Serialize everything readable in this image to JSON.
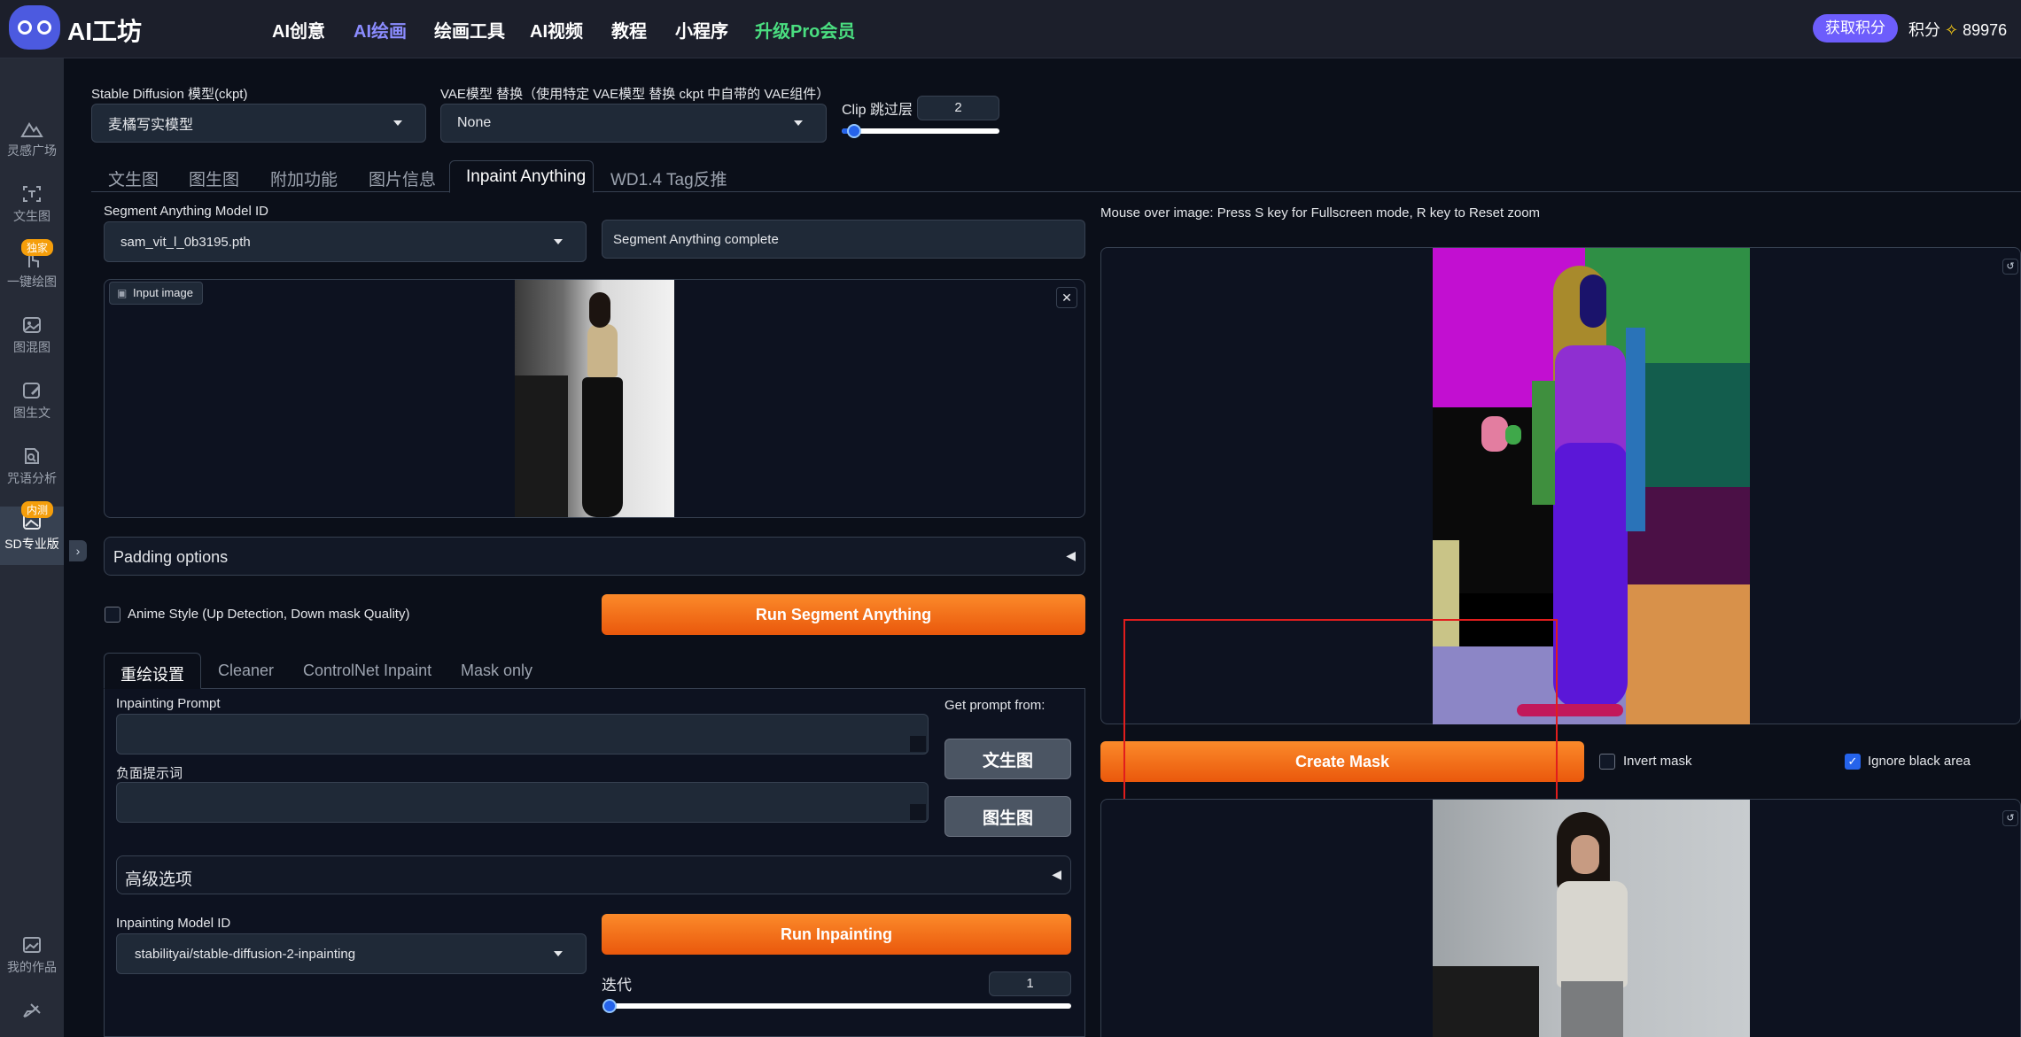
{
  "header": {
    "logo_text": "AI工坊",
    "nav": [
      "AI创意",
      "AI绘画",
      "绘画工具",
      "AI视频",
      "教程",
      "小程序",
      "升级Pro会员"
    ],
    "active_nav": "AI绘画",
    "get_points_label": "获取积分",
    "points_label": "积分",
    "points_value": "89976"
  },
  "sidebar": {
    "items": [
      {
        "label": "灵感广场",
        "icon": "mountain-icon"
      },
      {
        "label": "文生图",
        "icon": "text-frame-icon"
      },
      {
        "label": "一键绘图",
        "icon": "hand-pointer-icon",
        "badge": "独家"
      },
      {
        "label": "图混图",
        "icon": "image-mix-icon"
      },
      {
        "label": "图生文",
        "icon": "image-edit-icon"
      },
      {
        "label": "咒语分析",
        "icon": "analysis-icon"
      },
      {
        "label": "SD专业版",
        "icon": "image-pro-icon",
        "badge": "内测"
      }
    ],
    "bottom_items": [
      {
        "label": "我的作品",
        "icon": "gallery-icon"
      },
      {
        "label": "",
        "icon": "brush-icon"
      }
    ]
  },
  "model_bar": {
    "ckpt_label": "Stable Diffusion 模型(ckpt)",
    "ckpt_value": "麦橘写实模型",
    "vae_label": "VAE模型 替换（使用特定 VAE模型 替换 ckpt 中自带的 VAE组件）",
    "vae_value": "None",
    "clip_label": "Clip 跳过层",
    "clip_value": "2",
    "clip_slider_fraction": 0.08
  },
  "main_tabs": [
    "文生图",
    "图生图",
    "附加功能",
    "图片信息",
    "Inpaint Anything",
    "WD1.4 Tag反推"
  ],
  "active_main_tab": "Inpaint Anything",
  "left": {
    "sam_label": "Segment Anything Model ID",
    "sam_value": "sam_vit_l_0b3195.pth",
    "sam_status": "Segment Anything complete",
    "input_image_label": "Input image",
    "padding_options": "Padding options",
    "anime_style_label": "Anime Style (Up Detection, Down mask Quality)",
    "run_sam_label": "Run Segment Anything",
    "sub_tabs": [
      "重绘设置",
      "Cleaner",
      "ControlNet Inpaint",
      "Mask only"
    ],
    "active_sub_tab": "重绘设置",
    "prompt_label": "Inpainting Prompt",
    "get_prompt_label": "Get prompt from:",
    "txt2img_btn": "文生图",
    "neg_prompt_label": "负面提示词",
    "img2img_btn": "图生图",
    "advanced_label": "高级选项",
    "inpaint_model_label": "Inpainting Model ID",
    "inpaint_model_value": "stabilityai/stable-diffusion-2-inpainting",
    "run_inpaint_label": "Run Inpainting",
    "iterations_label": "迭代",
    "iterations_value": "1",
    "iterations_slider_fraction": 0.0
  },
  "right": {
    "hint_text": "Mouse over image: Press S key for Fullscreen mode, R key to Reset zoom",
    "create_mask_label": "Create Mask",
    "invert_mask_label": "Invert mask",
    "ignore_black_label": "Ignore black area",
    "ignore_black_checked": true,
    "invert_mask_checked": false
  }
}
